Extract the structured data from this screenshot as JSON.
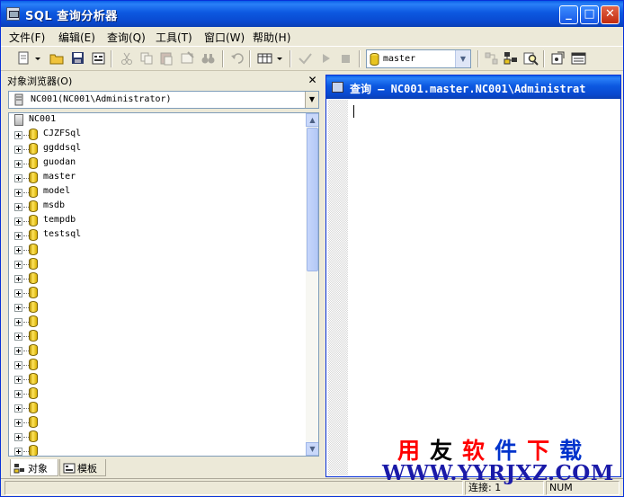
{
  "window": {
    "title": "SQL 查询分析器"
  },
  "menu": [
    {
      "label": "文件(F)"
    },
    {
      "label": "编辑(E)"
    },
    {
      "label": "查询(Q)"
    },
    {
      "label": "工具(T)"
    },
    {
      "label": "窗口(W)"
    },
    {
      "label": "帮助(H)"
    }
  ],
  "toolbar": {
    "database": "master"
  },
  "object_browser": {
    "title": "对象浏览器(O)",
    "server_combo": "NC001(NC001\\Administrator)",
    "server_node": "NC001",
    "databases": [
      "CJZFSql",
      "ggddsql",
      "guodan",
      "master",
      "model",
      "msdb",
      "tempdb",
      "testsql"
    ],
    "tabs": {
      "objects": "对象",
      "templates": "模板"
    }
  },
  "query_window": {
    "title": "查询 — NC001.master.NC001\\Administrat"
  },
  "statusbar": {
    "connections": "连接: 1",
    "num": "NUM"
  },
  "watermark": {
    "chars": [
      "用",
      "友",
      "软",
      "件",
      "下",
      "载"
    ],
    "colors": [
      "#ff0000",
      "#000000",
      "#ff0000",
      "#0033cc",
      "#ff0000",
      "#0033cc"
    ],
    "url": "WWW.YYRJXZ.COM"
  }
}
